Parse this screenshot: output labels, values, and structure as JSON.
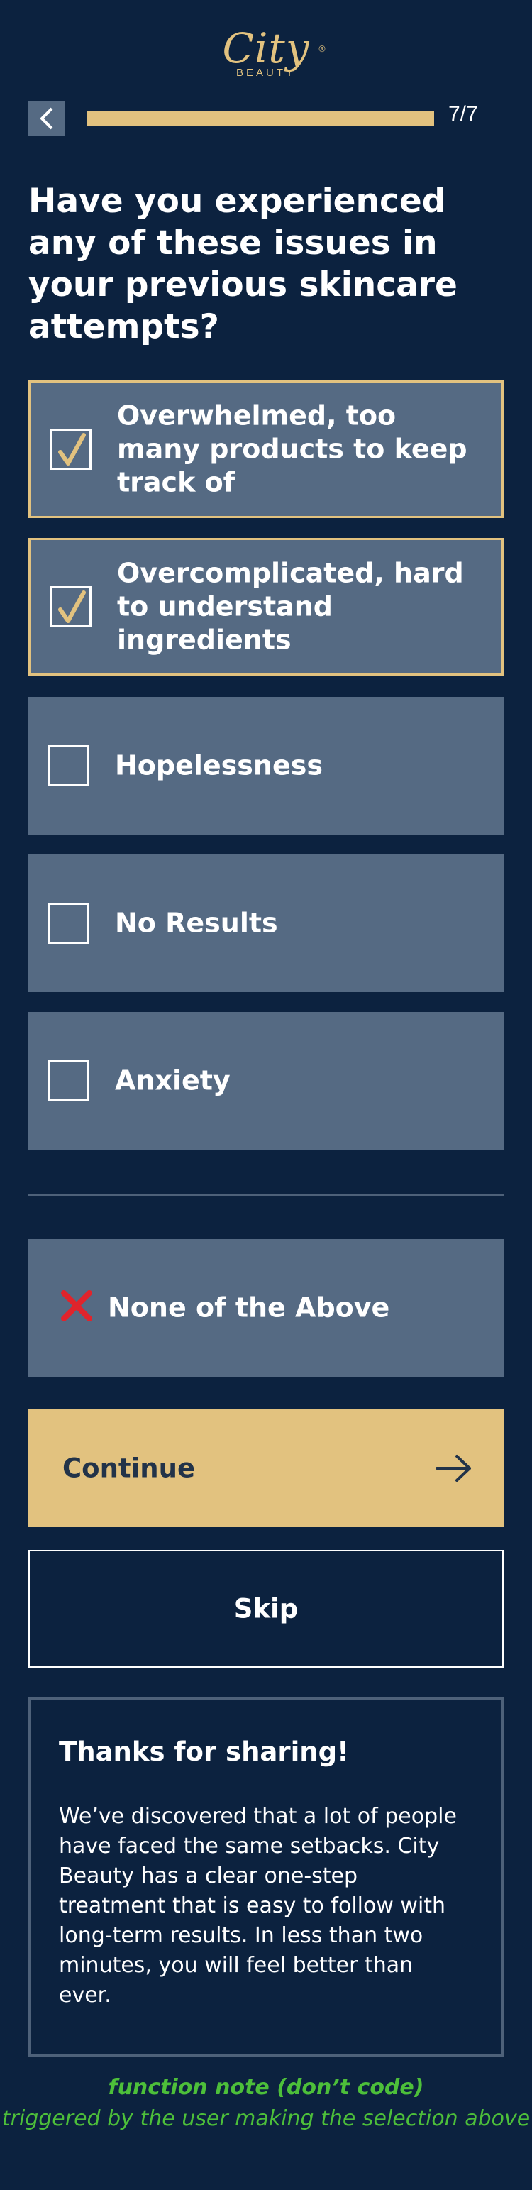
{
  "brand": {
    "script": "City",
    "sub": "BEAUTY",
    "registered": "®"
  },
  "progress": {
    "text": "7/7",
    "fraction": 1.0
  },
  "question": "Have you experienced any of these issues in your previous skincare attempts?",
  "options": [
    {
      "label": "Overwhelmed, too many products to keep track of",
      "checked": true
    },
    {
      "label": "Overcomplicated, hard to understand ingredients",
      "checked": true
    },
    {
      "label": "Hopelessness",
      "checked": false
    },
    {
      "label": "No Results",
      "checked": false
    },
    {
      "label": "Anxiety",
      "checked": false
    }
  ],
  "none_option": {
    "label": "None of the Above"
  },
  "buttons": {
    "continue": "Continue",
    "skip": "Skip"
  },
  "thanks": {
    "title": "Thanks for sharing!",
    "body": "We’ve discovered that a lot of people have faced the same setbacks. City Beauty has a clear one-step treatment that is easy to follow with long-term results. In less than two minutes, you will feel better than ever."
  },
  "note": {
    "title": "function note (don’t code)",
    "body": "triggered by the user making the selection above"
  },
  "colors": {
    "background": "#0c223f",
    "accent": "#e2c27f",
    "card": "#556a83",
    "note": "#4dbf3a",
    "danger": "#e0242c"
  },
  "icons": {
    "back": "chevron-left-icon",
    "check": "checkmark-icon",
    "none": "x-icon",
    "continue": "arrow-right-icon"
  }
}
